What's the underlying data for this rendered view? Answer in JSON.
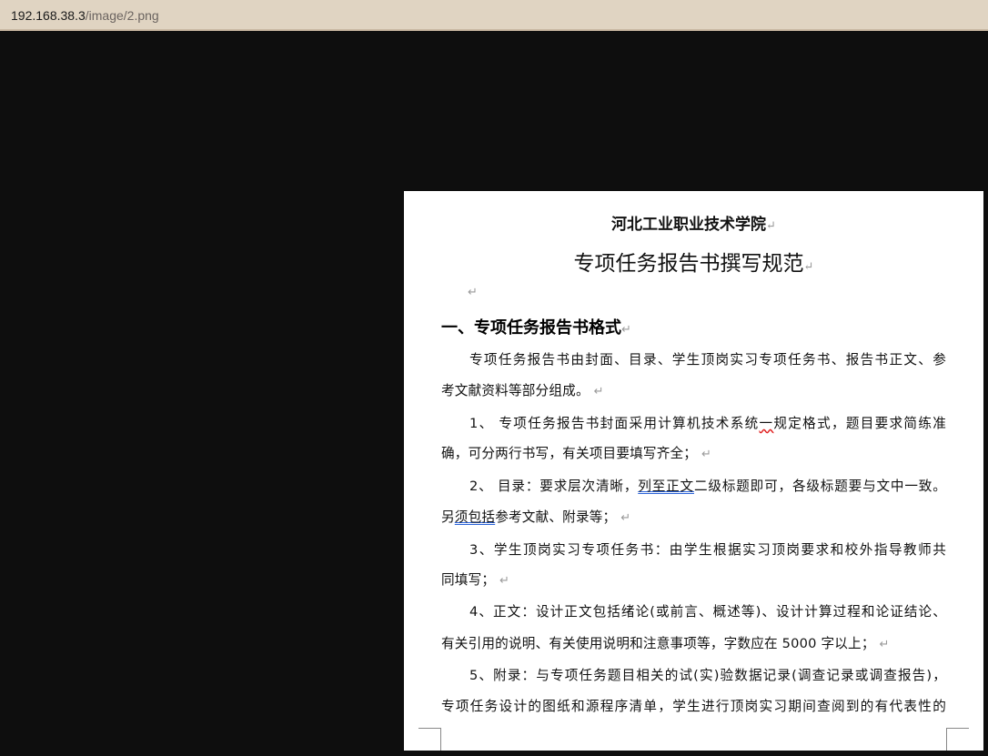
{
  "address_bar": {
    "host": "192.168.38.3",
    "path": "/image/2.png"
  },
  "document": {
    "title": "河北工业职业技术学院",
    "subtitle": "专项任务报告书撰写规范",
    "return_mark": "↵",
    "heading": "一、专项任务报告书格式",
    "lines": [
      {
        "text": "专项任务报告书由封面、目录、学生顶岗实习专项任务书、报告书正文、参"
      },
      {
        "text": "考文献资料等部分组成。"
      },
      {
        "a": "1、 专项任务报告书封面采用计算机技术系统",
        "b": "一",
        "c": "规定格式，题目要求简练准"
      },
      {
        "text": "确，可分两行书写，有关项目要填写齐全；"
      },
      {
        "a": "2、 目录：要求层次清晰，",
        "b": "列至正文",
        "c": "二级标题即可，各级标题要与文中一致。"
      },
      {
        "a": "另",
        "b": "须包括",
        "c": "参考文献、附录等；"
      },
      {
        "text": "3、学生顶岗实习专项任务书：由学生根据实习顶岗要求和校外指导教师共"
      },
      {
        "text": "同填写；"
      },
      {
        "text": "4、正文：设计正文包括绪论(或前言、概述等)、设计计算过程和论证结论、"
      },
      {
        "text": "有关引用的说明、有关使用说明和注意事项等，字数应在 5000 字以上；"
      },
      {
        "text": "5、附录：与专项任务题目相关的试(实)验数据记录(调查记录或调查报告)，"
      },
      {
        "text": "专项任务设计的图纸和源程序清单，学生进行顶岗实习期间查阅到的有代表性的"
      }
    ]
  }
}
